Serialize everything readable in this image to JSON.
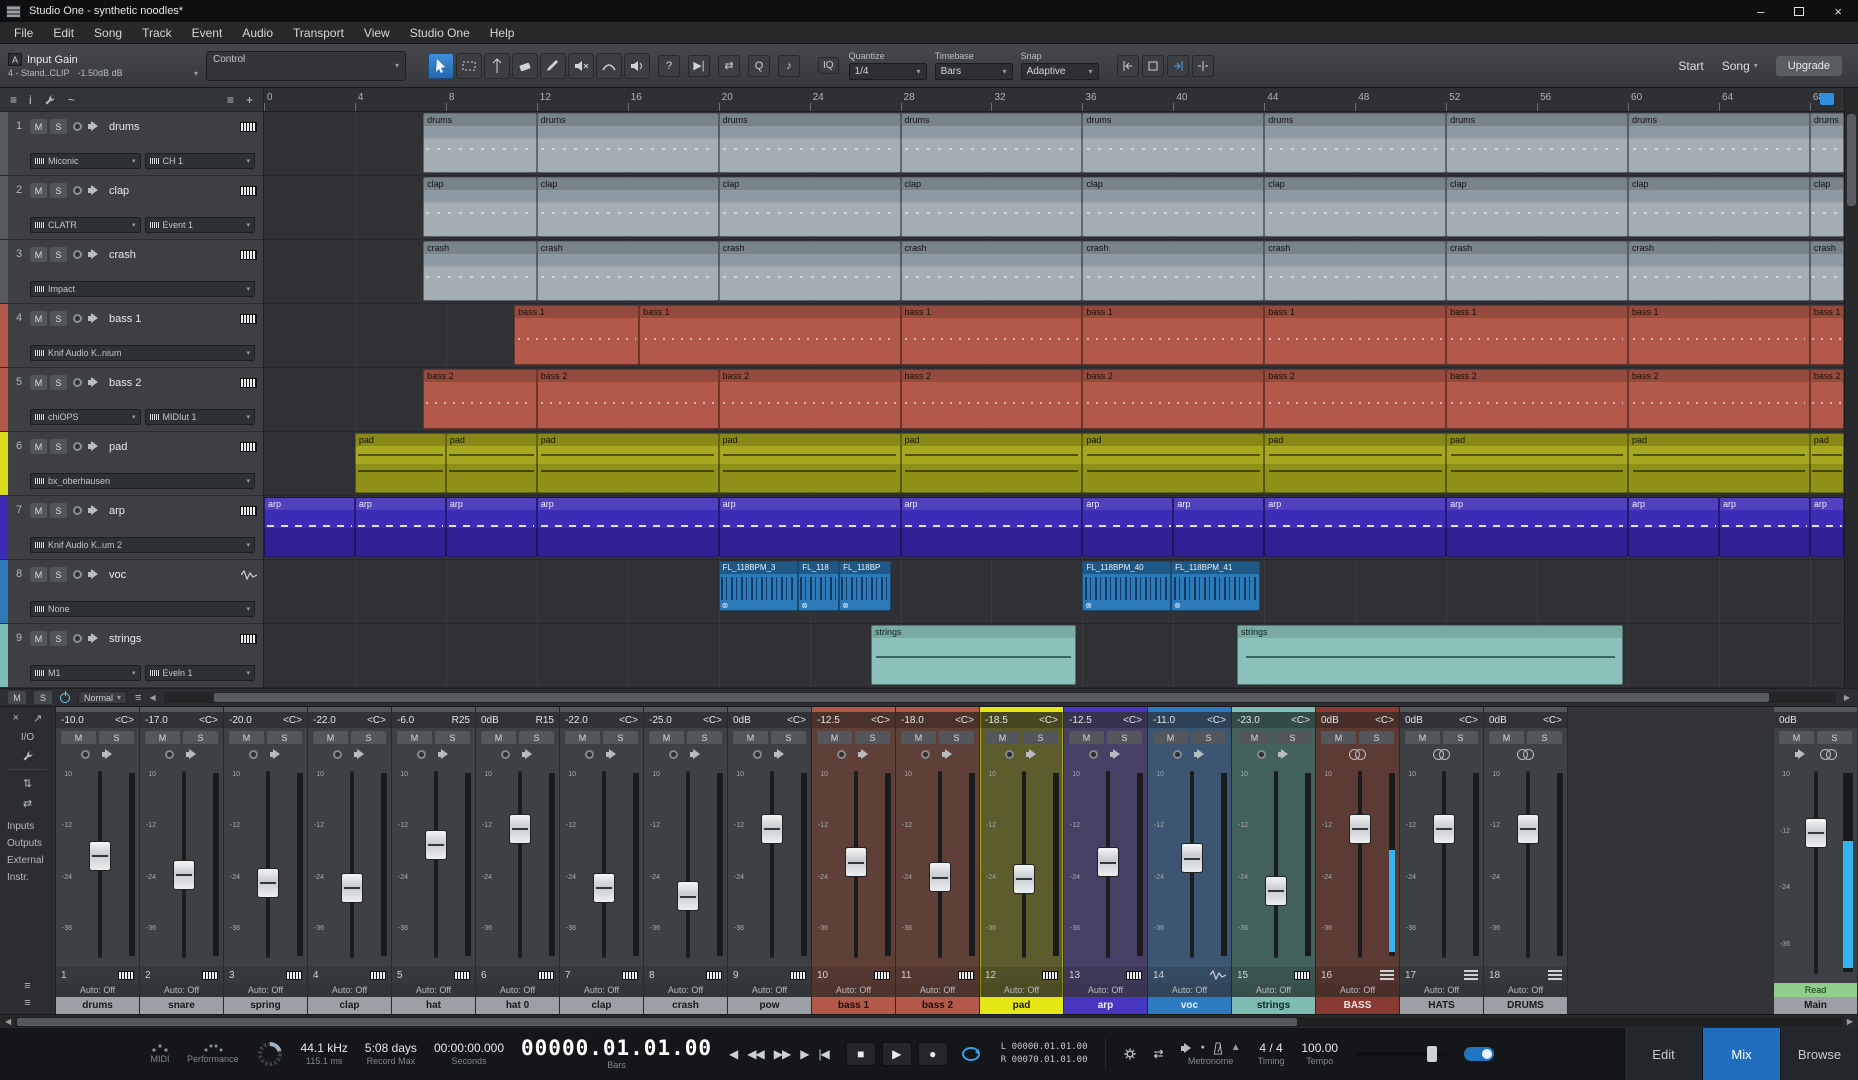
{
  "window": {
    "title": "Studio One - synthetic noodles*",
    "minimize": "–",
    "close": "×"
  },
  "menubar": {
    "items": [
      "File",
      "Edit",
      "Song",
      "Track",
      "Event",
      "Audio",
      "Transport",
      "View",
      "Studio One",
      "Help"
    ]
  },
  "icons": {
    "a": "A",
    "arrow": "▾",
    "menu": "≡",
    "info": "i",
    "tilde": "~",
    "plus": "+",
    "close": "×",
    "pin": "↗",
    "updown": "⇅",
    "leftright": "⇄",
    "scroll_left": "◀",
    "scroll_right": "▶",
    "prev": "◀",
    "rew": "◀◀",
    "fwd": "▶▶",
    "next": "▶",
    "rtz": "|◀",
    "stop": "■",
    "play": "▶",
    "record": "●",
    "warning": "▲",
    "note": "♪",
    "follow": "▶|"
  },
  "toolbar": {
    "input_gain": {
      "label": "Input Gain",
      "sub_left": "4 - Stand..CLIP",
      "sub_right": "-1.50dB dB"
    },
    "control_label": "Control",
    "help_label": "?",
    "q_label": "Q",
    "iq_label": "IQ",
    "quantize": {
      "label": "Quantize",
      "value": "1/4"
    },
    "timebase": {
      "label": "Timebase",
      "value": "Bars"
    },
    "snap": {
      "label": "Snap",
      "value": "Adaptive"
    },
    "start_label": "Start",
    "song_label": "Song",
    "upgrade_label": "Upgrade"
  },
  "ruler": {
    "bar_numbers": [
      0,
      4,
      8,
      12,
      16,
      20,
      24,
      28,
      32,
      36,
      40,
      44,
      48,
      52,
      56,
      60,
      64,
      68
    ],
    "total_bars": 69.5
  },
  "tracks": [
    {
      "num": "1",
      "name": "drums",
      "strip": "#555b5f",
      "clip_class": "ct-gray",
      "icon": "piano",
      "devices": [
        "Miconic",
        "CH 1"
      ],
      "clips": [
        {
          "label": "drums",
          "start": 7,
          "len": 5
        },
        {
          "label": "drums",
          "start": 12,
          "len": 8
        },
        {
          "label": "drums",
          "start": 20,
          "len": 8
        },
        {
          "label": "drums",
          "start": 28,
          "len": 8
        },
        {
          "label": "drums",
          "start": 36,
          "len": 8
        },
        {
          "label": "drums",
          "start": 44,
          "len": 8
        },
        {
          "label": "drums",
          "start": 52,
          "len": 8
        },
        {
          "label": "drums",
          "start": 60,
          "len": 8
        },
        {
          "label": "drums",
          "start": 68,
          "len": 1.5
        }
      ]
    },
    {
      "num": "2",
      "name": "clap",
      "strip": "#555b5f",
      "clip_class": "ct-gray",
      "icon": "piano",
      "devices": [
        "CLATR",
        "Event 1"
      ],
      "clips": [
        {
          "label": "clap",
          "start": 7,
          "len": 5
        },
        {
          "label": "clap",
          "start": 12,
          "len": 8
        },
        {
          "label": "clap",
          "start": 20,
          "len": 8
        },
        {
          "label": "clap",
          "start": 28,
          "len": 8
        },
        {
          "label": "clap",
          "start": 36,
          "len": 8
        },
        {
          "label": "clap",
          "start": 44,
          "len": 8
        },
        {
          "label": "clap",
          "start": 52,
          "len": 8
        },
        {
          "label": "clap",
          "start": 60,
          "len": 8
        },
        {
          "label": "clap",
          "start": 68,
          "len": 1.5
        }
      ]
    },
    {
      "num": "3",
      "name": "crash",
      "strip": "#555b5f",
      "clip_class": "ct-gray",
      "icon": "piano",
      "devices": [
        "Impact"
      ],
      "clips": [
        {
          "label": "crash",
          "start": 7,
          "len": 5
        },
        {
          "label": "crash",
          "start": 12,
          "len": 8
        },
        {
          "label": "crash",
          "start": 20,
          "len": 8
        },
        {
          "label": "crash",
          "start": 28,
          "len": 8
        },
        {
          "label": "crash",
          "start": 36,
          "len": 8
        },
        {
          "label": "crash",
          "start": 44,
          "len": 8
        },
        {
          "label": "crash",
          "start": 52,
          "len": 8
        },
        {
          "label": "crash",
          "start": 60,
          "len": 8
        },
        {
          "label": "crash",
          "start": 68,
          "len": 1.5
        }
      ]
    },
    {
      "num": "4",
      "name": "bass 1",
      "strip": "#b2594a",
      "clip_class": "ct-bass",
      "icon": "piano",
      "devices": [
        "Knif Audio K..nium"
      ],
      "clips": [
        {
          "label": "bass 1",
          "start": 11,
          "len": 5.5
        },
        {
          "label": "bass 1",
          "start": 16.5,
          "len": 11.5
        },
        {
          "label": "bass 1",
          "start": 28,
          "len": 8
        },
        {
          "label": "bass 1",
          "start": 36,
          "len": 8
        },
        {
          "label": "bass 1",
          "start": 44,
          "len": 8
        },
        {
          "label": "bass 1",
          "start": 52,
          "len": 8
        },
        {
          "label": "bass 1",
          "start": 60,
          "len": 8
        },
        {
          "label": "bass 1",
          "start": 68,
          "len": 1.5
        }
      ]
    },
    {
      "num": "5",
      "name": "bass 2",
      "strip": "#b2594a",
      "clip_class": "ct-bass",
      "icon": "piano",
      "devices": [
        "chiOPS",
        "MIDIut 1"
      ],
      "clips": [
        {
          "label": "bass 2",
          "start": 7,
          "len": 5
        },
        {
          "label": "bass 2",
          "start": 12,
          "len": 8
        },
        {
          "label": "bass 2",
          "start": 20,
          "len": 8
        },
        {
          "label": "bass 2",
          "start": 28,
          "len": 8
        },
        {
          "label": "bass 2",
          "start": 36,
          "len": 8
        },
        {
          "label": "bass 2",
          "start": 44,
          "len": 8
        },
        {
          "label": "bass 2",
          "start": 52,
          "len": 8
        },
        {
          "label": "bass 2",
          "start": 60,
          "len": 8
        },
        {
          "label": "bass 2",
          "start": 68,
          "len": 1.5
        }
      ]
    },
    {
      "num": "6",
      "name": "pad",
      "strip": "#d8da1e",
      "clip_class": "ct-pad",
      "icon": "piano",
      "devices": [
        "bx_oberhausen"
      ],
      "clips": [
        {
          "label": "pad",
          "start": 4,
          "len": 4
        },
        {
          "label": "pad",
          "start": 8,
          "len": 4
        },
        {
          "label": "pad",
          "start": 12,
          "len": 8
        },
        {
          "label": "pad",
          "start": 20,
          "len": 8
        },
        {
          "label": "pad",
          "start": 28,
          "len": 8
        },
        {
          "label": "pad",
          "start": 36,
          "len": 8
        },
        {
          "label": "pad",
          "start": 44,
          "len": 8
        },
        {
          "label": "pad",
          "start": 52,
          "len": 8
        },
        {
          "label": "pad",
          "start": 60,
          "len": 8
        },
        {
          "label": "pad",
          "start": 68,
          "len": 1.5
        }
      ]
    },
    {
      "num": "7",
      "name": "arp",
      "strip": "#3b2db6",
      "clip_class": "ct-arp",
      "icon": "piano",
      "devices": [
        "Knif Audio K..um 2"
      ],
      "clips": [
        {
          "label": "arp",
          "start": 0,
          "len": 4
        },
        {
          "label": "arp",
          "start": 4,
          "len": 4
        },
        {
          "label": "arp",
          "start": 8,
          "len": 4
        },
        {
          "label": "arp",
          "start": 12,
          "len": 8
        },
        {
          "label": "arp",
          "start": 20,
          "len": 8
        },
        {
          "label": "arp",
          "start": 28,
          "len": 8
        },
        {
          "label": "arp",
          "start": 36,
          "len": 4
        },
        {
          "label": "arp",
          "start": 40,
          "len": 4
        },
        {
          "label": "arp",
          "start": 44,
          "len": 8
        },
        {
          "label": "arp",
          "start": 52,
          "len": 8
        },
        {
          "label": "arp",
          "start": 60,
          "len": 4
        },
        {
          "label": "arp",
          "start": 64,
          "len": 4
        },
        {
          "label": "arp",
          "start": 68,
          "len": 1.5
        }
      ]
    },
    {
      "num": "8",
      "name": "voc",
      "strip": "#2e7ab8",
      "clip_class": "ct-voc",
      "icon": "wave",
      "devices": [
        "None"
      ],
      "clips": [
        {
          "label": "FL_118BPM_3",
          "start": 20,
          "len": 3.5
        },
        {
          "label": "FL_118",
          "start": 23.5,
          "len": 1.8
        },
        {
          "label": "FL_118BP",
          "start": 25.3,
          "len": 2.3
        },
        {
          "label": "FL_118BPM_40",
          "start": 36,
          "len": 3.9
        },
        {
          "label": "FL_118BPM_41",
          "start": 39.9,
          "len": 3.9
        }
      ]
    },
    {
      "num": "9",
      "name": "strings",
      "strip": "#7fbcb4",
      "clip_class": "ct-strings",
      "icon": "piano",
      "devices": [
        "M1",
        "Eveln 1"
      ],
      "clips": [
        {
          "label": "strings",
          "start": 26.7,
          "len": 9
        },
        {
          "label": "strings",
          "start": 42.8,
          "len": 17
        }
      ]
    }
  ],
  "arrange_footer": {
    "mute": "M",
    "solo": "S",
    "mode": "Normal"
  },
  "mixer": {
    "sidebar": {
      "io": "I/O",
      "items": [
        "Inputs",
        "Outputs",
        "External",
        "Instr."
      ]
    },
    "mute_label": "M",
    "solo_label": "S",
    "auto_label": "Auto: Off",
    "fader_scale": [
      "10",
      "-12",
      "-24",
      "-36"
    ],
    "channels": [
      {
        "num": "1",
        "name": "drums",
        "gain": "-10.0",
        "db": -10,
        "pan": "<C>"
      },
      {
        "num": "2",
        "name": "snare",
        "gain": "-17.0",
        "db": -17,
        "pan": "<C>"
      },
      {
        "num": "3",
        "name": "spring",
        "gain": "-20.0",
        "db": -20,
        "pan": "<C>"
      },
      {
        "num": "4",
        "name": "clap",
        "gain": "-22.0",
        "db": -22,
        "pan": "<C>"
      },
      {
        "num": "5",
        "name": "hat",
        "gain": "-6.0",
        "db": -6,
        "pan": "R25"
      },
      {
        "num": "6",
        "name": "hat 0",
        "gain": "0dB",
        "db": 0,
        "pan": "R15"
      },
      {
        "num": "7",
        "name": "clap",
        "gain": "-22.0",
        "db": -22,
        "pan": "<C>"
      },
      {
        "num": "8",
        "name": "crash",
        "gain": "-25.0",
        "db": -25,
        "pan": "<C>"
      },
      {
        "num": "9",
        "name": "pow",
        "gain": "0dB",
        "db": 0,
        "pan": "<C>"
      },
      {
        "num": "10",
        "name": "bass 1",
        "gain": "-12.5",
        "db": -12.5,
        "pan": "<C>",
        "tab": "#b2594a",
        "tint": "#5f4038",
        "name_bg": "#b2594a",
        "name_fg": "#1d0f0b"
      },
      {
        "num": "11",
        "name": "bass 2",
        "gain": "-18.0",
        "db": -18,
        "pan": "<C>",
        "tab": "#b2594a",
        "tint": "#5f4038",
        "name_bg": "#b2594a",
        "name_fg": "#1d0f0b"
      },
      {
        "num": "12",
        "name": "pad",
        "gain": "-18.5",
        "db": -18.5,
        "pan": "<C>",
        "tab": "#e4e616",
        "tint": "#5c5c2c",
        "name_bg": "#e4e616",
        "name_fg": "#1a1a04",
        "selected": true
      },
      {
        "num": "13",
        "name": "arp",
        "gain": "-12.5",
        "db": -12.5,
        "pan": "<C>",
        "tab": "#4636c0",
        "tint": "#474064",
        "name_bg": "#4636c0",
        "name_fg": "#eef0ff"
      },
      {
        "num": "14",
        "name": "voc",
        "gain": "-11.0",
        "db": -11,
        "pan": "<C>",
        "tab": "#2e7ac0",
        "tint": "#3c5570",
        "name_bg": "#2e7ac0",
        "name_fg": "#eaf2fb",
        "icon": "wave"
      },
      {
        "num": "15",
        "name": "strings",
        "gain": "-23.0",
        "db": -23,
        "pan": "<C>",
        "tab": "#7fbcb4",
        "tint": "#42615b",
        "name_bg": "#7fbcb4",
        "name_fg": "#102722"
      },
      {
        "num": "16",
        "name": "BASS",
        "gain": "0dB",
        "db": 0,
        "pan": "<C>",
        "tab": "#8a3a30",
        "tint": "#5c3b34",
        "name_bg": "#8a3a30",
        "name_fg": "#f0e6e4",
        "icon": "group",
        "link": true,
        "meter": true
      },
      {
        "num": "17",
        "name": "HATS",
        "gain": "0dB",
        "db": 0,
        "pan": "<C>",
        "icon": "group",
        "link": true
      },
      {
        "num": "18",
        "name": "DRUMS",
        "gain": "0dB",
        "db": 0,
        "pan": "<C>",
        "icon": "group",
        "link": true
      }
    ],
    "main": {
      "gain": "0dB",
      "read": "Read",
      "name": "Main"
    }
  },
  "transport": {
    "midi_label": "MIDI",
    "performance_label": "Performance",
    "sample_rate": "44.1 kHz",
    "latency": "115.1 ms",
    "record_time": "5:08 days",
    "record_label": "Record Max",
    "seconds_value": "00:00:00.000",
    "seconds_label": "Seconds",
    "bars_value": "00000.01.01.00",
    "bars_label": "Bars",
    "loop_l": "L 00000.01.01.00",
    "loop_r": "R 00070.01.01.00",
    "metronome_label": "Metronome",
    "time_sig": "4 / 4",
    "time_sig_label": "Timing",
    "tempo": "100.00",
    "tempo_label": "Tempo",
    "edit_label": "Edit",
    "mix_label": "Mix",
    "browse_label": "Browse"
  }
}
